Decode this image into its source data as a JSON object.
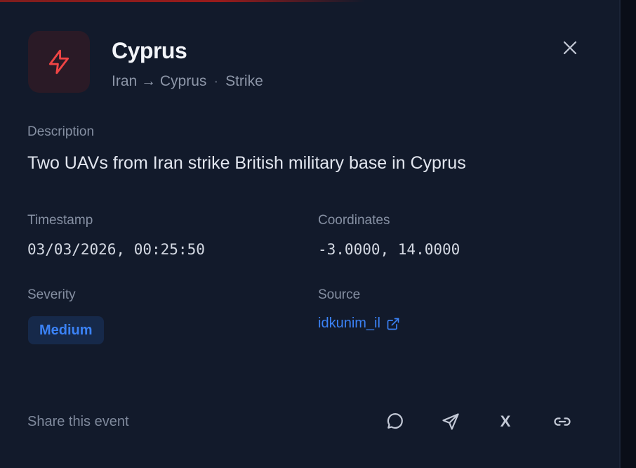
{
  "event": {
    "title": "Cyprus",
    "origin": "Iran",
    "arrow": "→",
    "target": "Cyprus",
    "separator": "·",
    "type": "Strike",
    "icon": "lightning-icon"
  },
  "description": {
    "label": "Description",
    "text": "Two UAVs from Iran strike British military base in Cyprus"
  },
  "timestamp": {
    "label": "Timestamp",
    "value": "03/03/2026, 00:25:50"
  },
  "coordinates": {
    "label": "Coordinates",
    "value": "-3.0000, 14.0000"
  },
  "severity": {
    "label": "Severity",
    "value": "Medium"
  },
  "source": {
    "label": "Source",
    "value": "idkunim_il",
    "icon": "external-link-icon"
  },
  "share": {
    "label": "Share this event",
    "x_label": "X",
    "icons": [
      "chat-bubble-icon",
      "send-icon",
      "x-icon",
      "link-icon"
    ]
  },
  "colors": {
    "background": "#121a2b",
    "accent_red": "#ef4444",
    "accent_blue": "#3b82f6"
  }
}
